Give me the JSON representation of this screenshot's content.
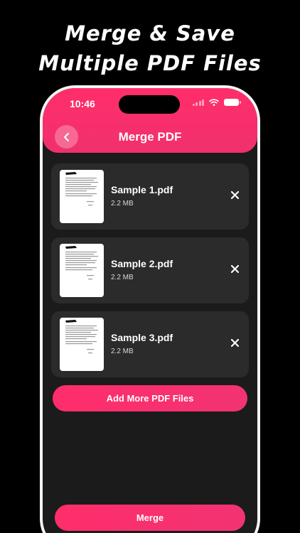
{
  "promo": {
    "line1": "Merge & Save",
    "line2": "Multiple PDF Files"
  },
  "status_bar": {
    "time": "10:46",
    "icons": [
      "signal-icon",
      "wifi-icon",
      "battery-icon"
    ]
  },
  "header": {
    "back_icon": "chevron-left-icon",
    "title": "Merge PDF"
  },
  "files": [
    {
      "name": "Sample 1.pdf",
      "size": "2.2 MB"
    },
    {
      "name": "Sample 2.pdf",
      "size": "2.2 MB"
    },
    {
      "name": "Sample 3.pdf",
      "size": "2.2 MB"
    }
  ],
  "actions": {
    "add_more_label": "Add More PDF Files",
    "merge_label": "Merge",
    "remove_icon": "close-icon"
  },
  "colors": {
    "accent": "#ff2e6a",
    "background": "#000000",
    "app_background": "#1b1b1b",
    "card": "#2b2b2b"
  }
}
